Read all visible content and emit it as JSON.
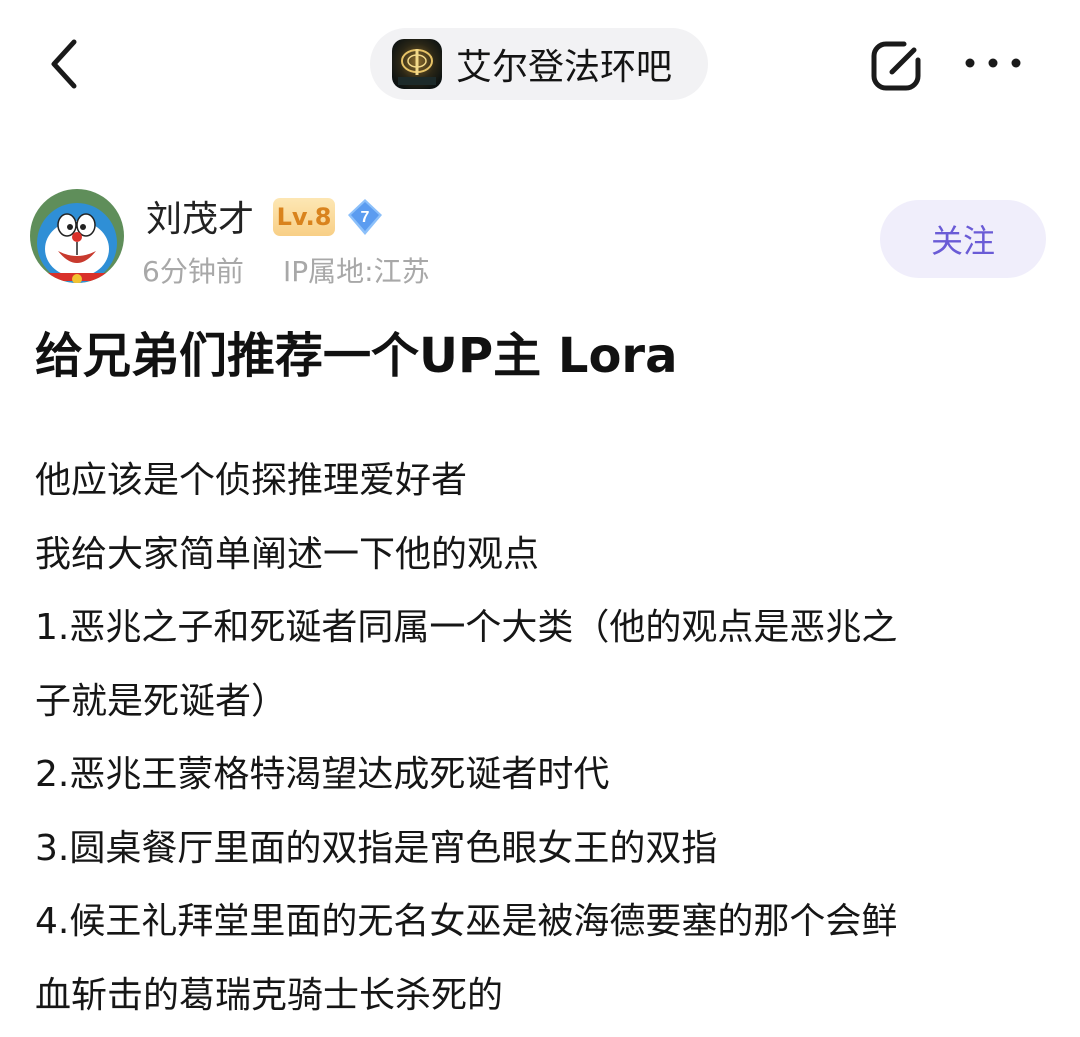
{
  "header": {
    "back_icon": "chevron-left-icon",
    "forum_logo_icon": "forum-logo-icon",
    "forum_name": "艾尔登法环吧",
    "edit_icon": "edit-icon",
    "more_icon": "more-icon"
  },
  "author": {
    "avatar_icon": "avatar-icon",
    "name": "刘茂才",
    "level": "Lv.8",
    "diamond_badge": "7",
    "time": "6分钟前",
    "ip_location": "IP属地:江苏",
    "follow_label": "关注"
  },
  "post": {
    "title": "给兄弟们推荐一个UP主 Lora",
    "lines": [
      "他应该是个侦探推理爱好者",
      "我给大家简单阐述一下他的观点",
      "1.恶兆之子和死诞者同属一个大类（他的观点是恶兆之",
      "子就是死诞者）",
      "2.恶兆王蒙格特渴望达成死诞者时代",
      "3.圆桌餐厅里面的双指是宵色眼女王的双指",
      "4.候王礼拜堂里面的无名女巫是被海德要塞的那个会鲜",
      "血斩击的葛瑞克骑士长杀死的"
    ]
  },
  "colors": {
    "accent": "#6a5bd6",
    "follow_bg": "#f0eefb",
    "level_text": "#d9831d",
    "diamond": "#5b9cf0",
    "meta_text": "#a8a8a8"
  }
}
